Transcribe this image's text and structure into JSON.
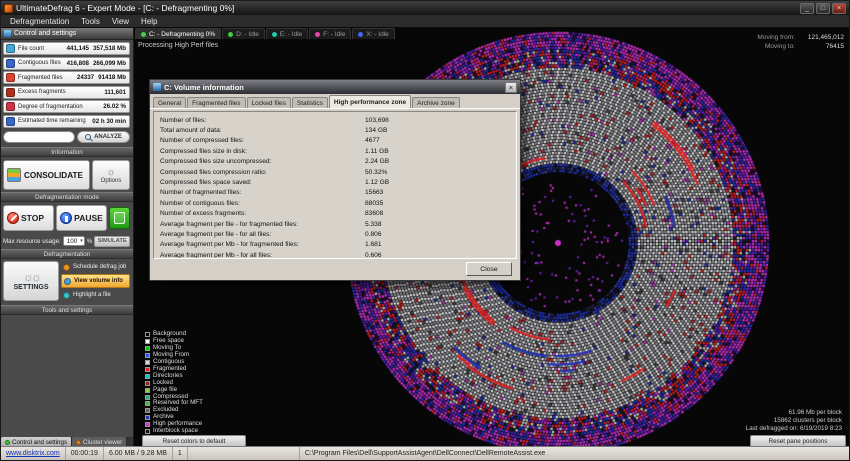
{
  "window": {
    "title": "UltimateDefrag 6 - Expert Mode - [C: - Defragmenting 0%]",
    "menus": [
      "Defragmentation",
      "Tools",
      "View",
      "Help"
    ]
  },
  "left_panel": {
    "header": "Control and settings",
    "stats": [
      {
        "label": "File count",
        "value": "441,145",
        "value2": "357,518 Mb",
        "icon": "files-icon",
        "icon_color": "#45a8d8"
      },
      {
        "label": "Contiguous files",
        "value": "416,808",
        "value2": "266,099 Mb",
        "icon": "contiguous-icon",
        "icon_color": "#3a66cc"
      },
      {
        "label": "Fragmented files",
        "value": "24337",
        "value2": "91418 Mb",
        "icon": "fragmented-icon",
        "icon_color": "#d8452a"
      },
      {
        "label": "Excess fragments",
        "value": "",
        "value2": "111,601",
        "icon": "excess-fragments-icon",
        "icon_color": "#b03020"
      },
      {
        "label": "Degree of fragmentation",
        "value": "",
        "value2": "26.02 %",
        "icon": "gauge-icon",
        "icon_color": "#cc3344"
      },
      {
        "label": "Estimated time remaining",
        "value": "",
        "value2": "02 h 30 min",
        "icon": "clock-icon",
        "icon_color": "#3a66cc"
      }
    ],
    "analyze_label": "ANALYZE",
    "sections": {
      "information": "Information",
      "defrag_mode": "Defragmentation mode",
      "defragmentation": "Defragmentation",
      "tools": "Tools and settings"
    },
    "consolidate_label": "CONSOLIDATE",
    "options_label": "Options",
    "stop_label": "STOP",
    "pause_label": "PAUSE",
    "resource": {
      "label": "Max resource usage:",
      "value": "100",
      "unit": "%",
      "simulate_label": "SIMULATE"
    },
    "settings_label": "SETTINGS",
    "tool_options": [
      {
        "label": "Schedule defrag job",
        "icon_color": "#f09020",
        "active": false
      },
      {
        "label": "View volume info",
        "icon_color": "#4aa0e0",
        "active": true
      },
      {
        "label": "Highlight a file",
        "icon_color": "#38c0c8",
        "active": false
      }
    ],
    "tabs": [
      {
        "label": "Control and settings",
        "dot": "#33cc33",
        "active": true
      },
      {
        "label": "Cluster viewer",
        "dot": "#ee8822",
        "active": false
      }
    ],
    "status": {
      "site": "www.disktrix.com",
      "time": "00:00:19",
      "memory": "6.00 MB / 9.28 MB"
    }
  },
  "main": {
    "drive_tabs": [
      {
        "label": "C: - Defragmenting 0%",
        "color": "#44cc44",
        "active": true
      },
      {
        "label": "D: - Idle",
        "color": "#44cc44",
        "active": false
      },
      {
        "label": "E: - Idle",
        "color": "#22ccaa",
        "active": false
      },
      {
        "label": "F: - Idle",
        "color": "#ee44aa",
        "active": false
      },
      {
        "label": "X: - Idle",
        "color": "#4466ee",
        "active": false
      }
    ],
    "processing_text": "Processing High Perf files",
    "moving": [
      {
        "label": "Moving from:",
        "value": "121,465,012"
      },
      {
        "label": "Moving to:",
        "value": "76415"
      }
    ],
    "block_info": [
      "61.96 Mb per block",
      "15862 clusters per block",
      "Last defragged on: 6/19/2019 8:23"
    ],
    "reset_colors_label": "Reset colors to default",
    "reset_panes_label": "Reset pane positions"
  },
  "legend": {
    "items": [
      {
        "key": "background",
        "label": "Background",
        "color": "#000000"
      },
      {
        "key": "free_space",
        "label": "Free space",
        "color": "#ffffff"
      },
      {
        "key": "moving_to",
        "label": "Moving To",
        "color": "#00cc00"
      },
      {
        "key": "moving_from",
        "label": "Moving From",
        "color": "#2255ff"
      },
      {
        "key": "contiguous",
        "label": "Contiguous",
        "color": "#d8d8d8"
      },
      {
        "key": "fragmented",
        "label": "Fragmented",
        "color": "#dd2222"
      },
      {
        "key": "directories",
        "label": "Directories",
        "color": "#00cccc"
      },
      {
        "key": "locked",
        "label": "Locked",
        "color": "#882222"
      },
      {
        "key": "page_file",
        "label": "Page file",
        "color": "#88cc44"
      },
      {
        "key": "compressed",
        "label": "Compressed",
        "color": "#22aa88"
      },
      {
        "key": "reserved_mft",
        "label": "Reserved for MFT",
        "color": "#44bb44"
      },
      {
        "key": "excluded",
        "label": "Excluded",
        "color": "#666666"
      },
      {
        "key": "archive",
        "label": "Archive",
        "color": "#2233bb"
      },
      {
        "key": "high_performance",
        "label": "High performance",
        "color": "#cc33cc"
      },
      {
        "key": "interblock",
        "label": "Interblock space",
        "color": "#111111"
      }
    ]
  },
  "dialog": {
    "title": "C: Volume information",
    "tabs": [
      {
        "label": "General",
        "active": false
      },
      {
        "label": "Fragmented files",
        "active": false
      },
      {
        "label": "Locked files",
        "active": false
      },
      {
        "label": "Statistics",
        "active": false
      },
      {
        "label": "High performance zone",
        "active": true
      },
      {
        "label": "Archive zone",
        "active": false
      }
    ],
    "rows": [
      {
        "label": "Number of files:",
        "value": "103,698"
      },
      {
        "label": "Total amount of data:",
        "value": "134 GB"
      },
      {
        "label": "Number of compressed files:",
        "value": "4677"
      },
      {
        "label": "Compressed files size in disk:",
        "value": "1.11 GB"
      },
      {
        "label": "Compressed files size uncompressed:",
        "value": "2.24 GB"
      },
      {
        "label": "Compressed files compression ratio:",
        "value": "50.32%"
      },
      {
        "label": "Compressed files space saved:",
        "value": "1.12 GB"
      },
      {
        "label": "Number of fragmented files:",
        "value": "15663"
      },
      {
        "label": "Number of contiguous files:",
        "value": "88035"
      },
      {
        "label": "Number of excess fragments:",
        "value": "83608"
      },
      {
        "label": "Average fragment per file - for fragmented files:",
        "value": "5.338"
      },
      {
        "label": "Average fragment per file - for all files:",
        "value": "0.806"
      },
      {
        "label": "Average fragment per Mb - for fragmented files:",
        "value": "1.681"
      },
      {
        "label": "Average fragment per Mb - for all files:",
        "value": "0.606"
      }
    ],
    "close_label": "Close"
  },
  "statusbar": {
    "count": "1",
    "path": "C:\\Program Files\\Dell\\SupportAssistAgent\\DellConnect\\DellRemoteAssist.exe"
  }
}
